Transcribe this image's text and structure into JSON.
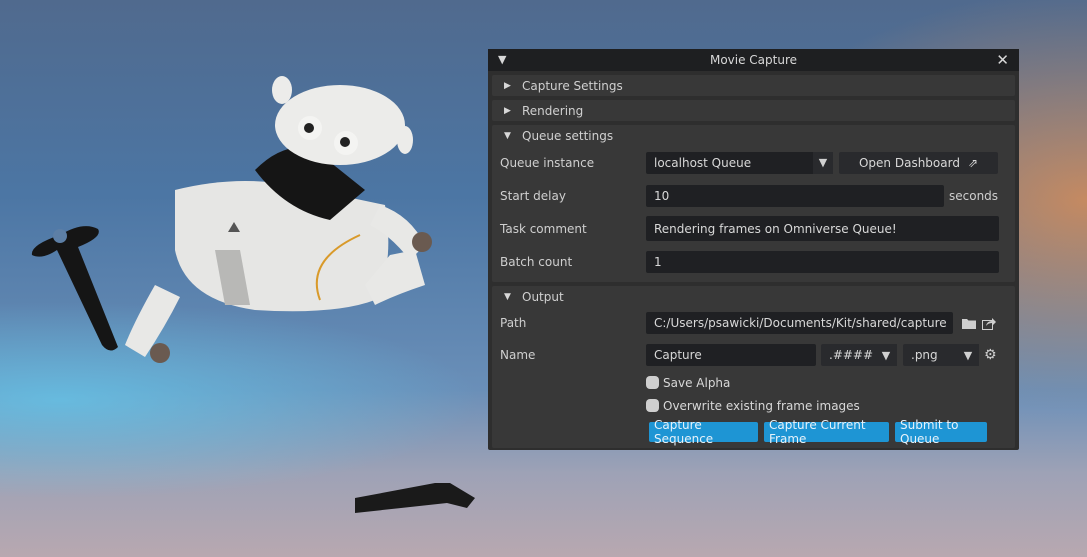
{
  "window": {
    "title": "Movie Capture",
    "collapse_icon": "triangle-down-icon",
    "close_icon": "close-icon"
  },
  "sections": {
    "capture_settings": {
      "label": "Capture Settings",
      "expanded": false
    },
    "rendering": {
      "label": "Rendering",
      "expanded": false
    },
    "queue_settings": {
      "label": "Queue settings",
      "expanded": true
    },
    "output": {
      "label": "Output",
      "expanded": true
    }
  },
  "queue": {
    "instance_label": "Queue instance",
    "instance_value": "localhost Queue",
    "open_dashboard_label": "Open Dashboard",
    "start_delay_label": "Start delay",
    "start_delay_value": "10",
    "start_delay_unit": "seconds",
    "task_comment_label": "Task comment",
    "task_comment_value": "Rendering frames on Omniverse Queue!",
    "batch_count_label": "Batch count",
    "batch_count_value": "1"
  },
  "output": {
    "path_label": "Path",
    "path_value": "C:/Users/psawicki/Documents/Kit/shared/capture",
    "name_label": "Name",
    "name_value": "Capture",
    "frame_pattern": ".####",
    "extension": ".png",
    "save_alpha_label": "Save Alpha",
    "save_alpha_checked": false,
    "overwrite_label": "Overwrite existing frame images",
    "overwrite_checked": false
  },
  "actions": {
    "capture_sequence": "Capture Sequence",
    "capture_current_frame": "Capture Current Frame",
    "submit_to_queue": "Submit to Queue"
  },
  "colors": {
    "accent": "#1e95d4",
    "panel_bg": "#2e2e2e",
    "section_bg": "#383838",
    "field_bg": "#1f2023"
  }
}
